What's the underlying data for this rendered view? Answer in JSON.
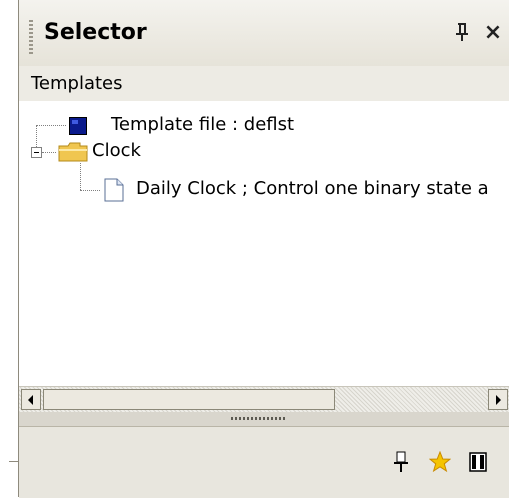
{
  "window": {
    "title": "Selector",
    "pin_icon": "pin-icon",
    "close_label": "×"
  },
  "section": {
    "label": "Templates"
  },
  "tree": {
    "items": [
      {
        "label": "Template file : deflst",
        "icon": "template-file-icon"
      },
      {
        "label": "Clock",
        "icon": "folder-icon",
        "expanded": true
      },
      {
        "label": "Daily Clock ; Control one binary state a",
        "icon": "document-icon"
      }
    ]
  },
  "toolbar": {
    "icons": [
      "dock-pin-icon",
      "favorites-star-icon",
      "panel-toggle-icon"
    ]
  },
  "colors": {
    "panel_bg": "#d9d6cd",
    "folder": "#f0c650",
    "template_icon": "#0a1a8c",
    "star": "#f5c400"
  }
}
